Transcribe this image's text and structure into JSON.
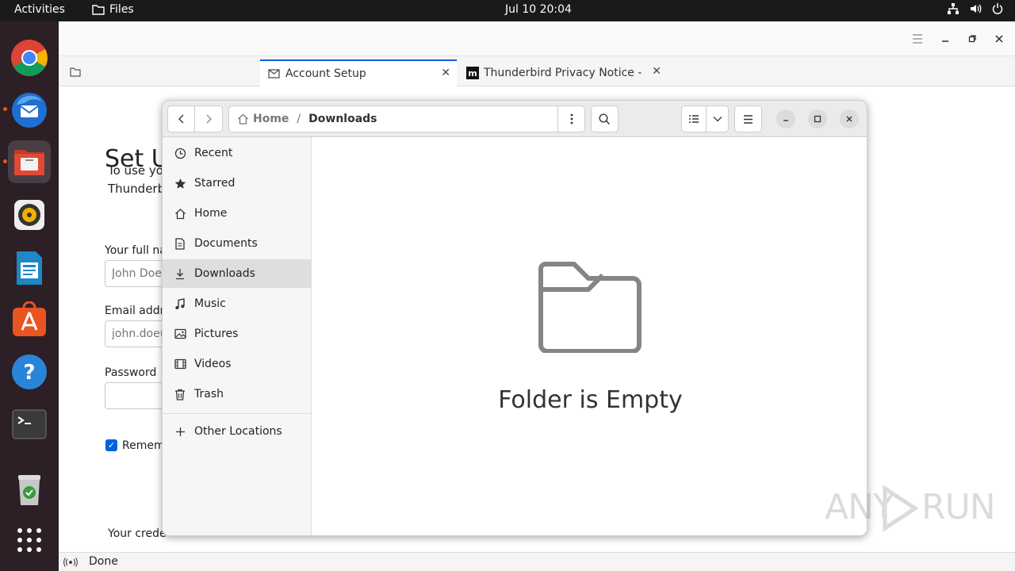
{
  "topbar": {
    "activities": "Activities",
    "app_name": "Files",
    "clock": "Jul 10  20:04"
  },
  "dock": {
    "items": [
      "chrome-icon",
      "thunderbird-icon",
      "files-icon",
      "rhythmbox-icon",
      "writer-icon",
      "app-center-icon",
      "help-icon",
      "terminal-icon",
      "trash-icon",
      "app-grid-icon"
    ]
  },
  "thunderbird": {
    "tabs": [
      {
        "label": "Account Setup"
      },
      {
        "label": "Thunderbird Privacy Notice -"
      }
    ],
    "account_setup": {
      "title": "Set U",
      "intro_line1": "To use yo",
      "intro_line2": "Thunderb",
      "fullname_label": "Your full na",
      "fullname_placeholder": "John Doe",
      "email_label": "Email addr",
      "email_placeholder": "john.doe(",
      "password_label": "Password",
      "remember_label": "Remem",
      "credentials_text": "Your crede"
    },
    "status_text": "Done"
  },
  "files": {
    "breadcrumb_home": "Home",
    "breadcrumb_sep": "/",
    "breadcrumb_current": "Downloads",
    "sidebar": [
      {
        "label": "Recent",
        "icon": "clock-icon"
      },
      {
        "label": "Starred",
        "icon": "star-icon"
      },
      {
        "label": "Home",
        "icon": "home-icon"
      },
      {
        "label": "Documents",
        "icon": "document-icon"
      },
      {
        "label": "Downloads",
        "icon": "download-icon",
        "selected": true
      },
      {
        "label": "Music",
        "icon": "music-icon"
      },
      {
        "label": "Pictures",
        "icon": "picture-icon"
      },
      {
        "label": "Videos",
        "icon": "video-icon"
      },
      {
        "label": "Trash",
        "icon": "trash-icon"
      }
    ],
    "other_locations": "Other Locations",
    "empty_message": "Folder is Empty"
  },
  "watermark": {
    "left": "ANY",
    "right": "RUN"
  }
}
